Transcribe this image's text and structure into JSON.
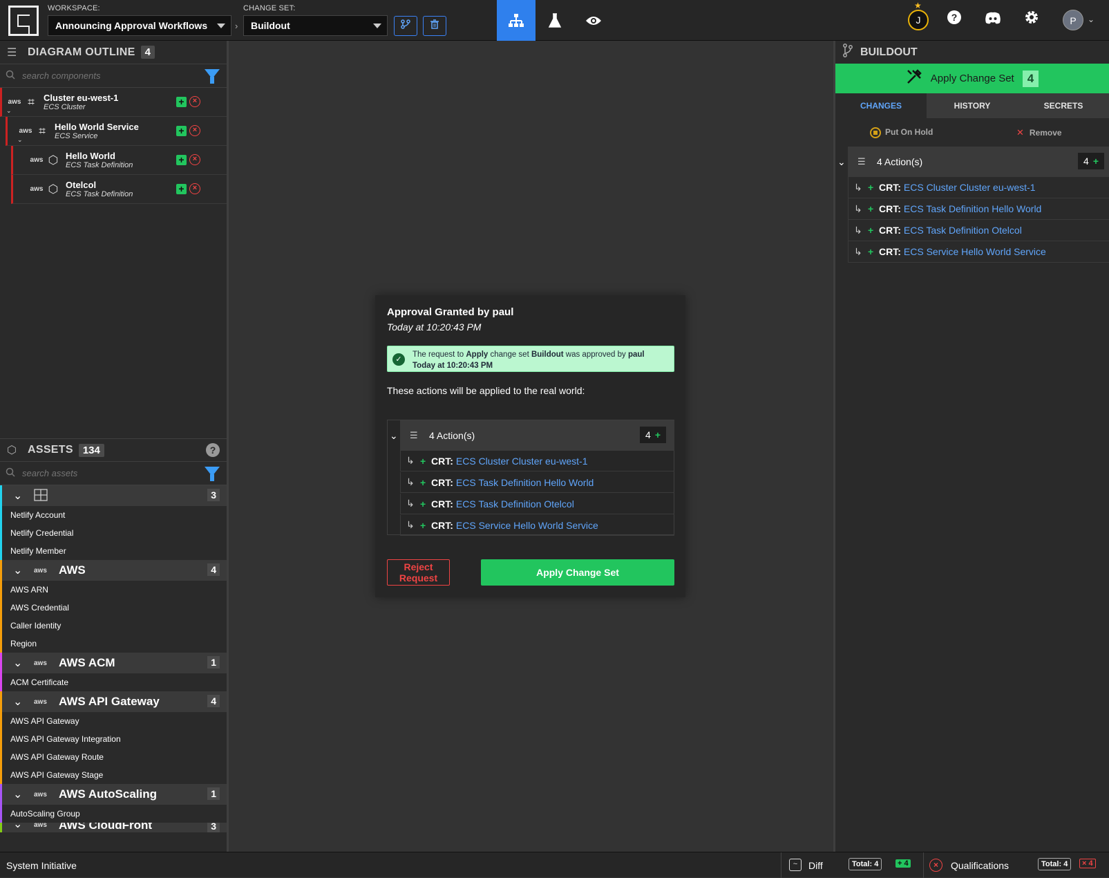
{
  "topbar": {
    "workspace_label": "WORKSPACE:",
    "workspace_value": "Announcing Approval Workflows",
    "changeset_label": "CHANGE SET:",
    "changeset_value": "Buildout",
    "user_initial": "J",
    "profile_initial": "P"
  },
  "outline": {
    "title": "DIAGRAM OUTLINE",
    "count": "4",
    "search_placeholder": "search components",
    "items": [
      {
        "name": "Cluster eu-west-1",
        "type": "ECS Cluster"
      },
      {
        "name": "Hello World Service",
        "type": "ECS Service"
      },
      {
        "name": "Hello World",
        "type": "ECS Task Definition"
      },
      {
        "name": "Otelcol",
        "type": "ECS Task Definition"
      }
    ],
    "aws_text": "aws"
  },
  "assets": {
    "title": "ASSETS",
    "count": "134",
    "search_placeholder": "search assets",
    "categories": [
      {
        "name": "",
        "count": "3",
        "items": [
          "Netlify Account",
          "Netlify Credential",
          "Netlify Member"
        ]
      },
      {
        "name": "AWS",
        "count": "4",
        "items": [
          "AWS ARN",
          "AWS Credential",
          "Caller Identity",
          "Region"
        ]
      },
      {
        "name": "AWS ACM",
        "count": "1",
        "items": [
          "ACM Certificate"
        ]
      },
      {
        "name": "AWS API Gateway",
        "count": "4",
        "items": [
          "AWS API Gateway",
          "AWS API Gateway Integration",
          "AWS API Gateway Route",
          "AWS API Gateway Stage"
        ]
      },
      {
        "name": "AWS AutoScaling",
        "count": "1",
        "items": [
          "AutoScaling Group"
        ]
      },
      {
        "name": "AWS CloudFront",
        "count": "3",
        "items": []
      }
    ]
  },
  "modal": {
    "title": "Approval Granted by paul",
    "time": "Today at 10:20:43 PM",
    "approval_prefix": "The request to ",
    "approval_action": "Apply",
    "approval_mid": " change set ",
    "approval_changeset": "Buildout",
    "approval_by": " was approved by ",
    "approval_user": "paul",
    "approval_time": "Today at 10:20:43 PM",
    "subtitle": "These actions will be applied to the real world:",
    "actions_title": "4 Action(s)",
    "actions_count": "4",
    "reject_label": "Reject Request",
    "apply_label": "Apply Change Set"
  },
  "actions": [
    {
      "kind": "CRT:",
      "target": "ECS Cluster Cluster eu-west-1"
    },
    {
      "kind": "CRT:",
      "target": "ECS Task Definition Hello World"
    },
    {
      "kind": "CRT:",
      "target": "ECS Task Definition Otelcol"
    },
    {
      "kind": "CRT:",
      "target": "ECS Service Hello World Service"
    }
  ],
  "rightpanel": {
    "title": "BUILDOUT",
    "apply_label": "Apply Change Set",
    "apply_count": "4",
    "tabs": [
      "CHANGES",
      "HISTORY",
      "SECRETS"
    ],
    "hold_label": "Put On Hold",
    "remove_label": "Remove",
    "actions_title": "4 Action(s)",
    "actions_count": "4"
  },
  "statusbar": {
    "brand": "System Initiative",
    "diff_label": "Diff",
    "diff_total_label": "Total:",
    "diff_total": "4",
    "diff_added": "4",
    "qual_label": "Qualifications",
    "qual_total_label": "Total:",
    "qual_total": "4",
    "qual_failed": "4"
  },
  "colors": {
    "accent": "#2f80ed",
    "success": "#22c55e",
    "danger": "#ef4444",
    "link": "#60a5fa"
  }
}
